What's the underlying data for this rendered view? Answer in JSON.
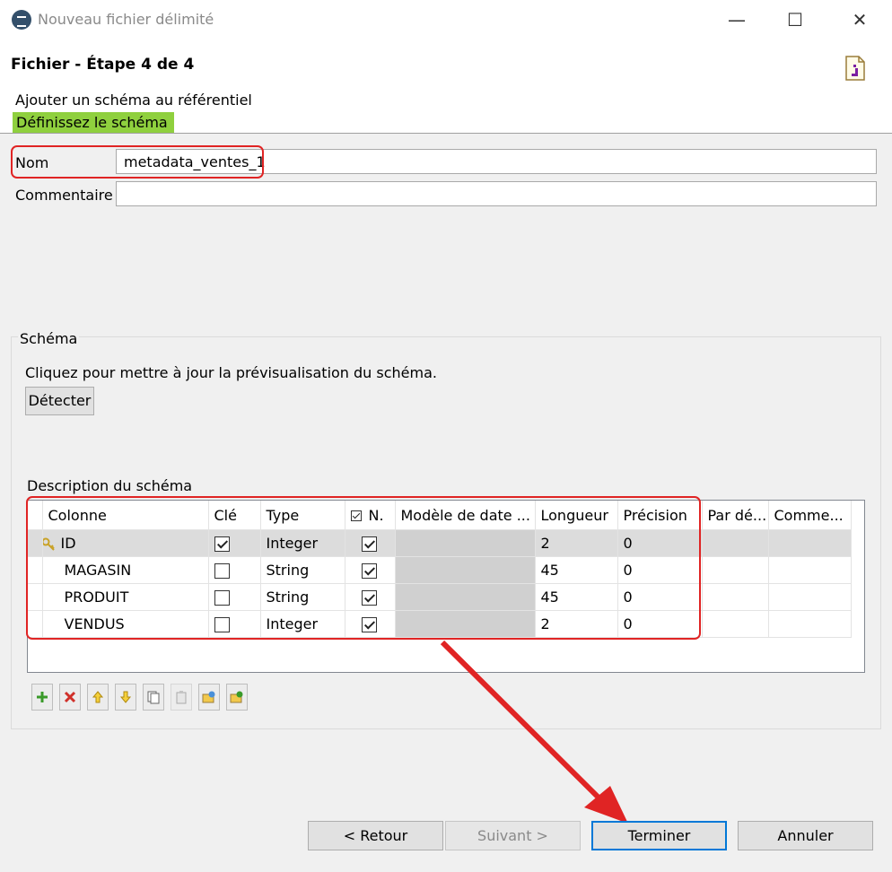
{
  "window": {
    "title": "Nouveau fichier délimité",
    "controls": {
      "minimize": "—",
      "maximize": "☐",
      "close": "✕"
    }
  },
  "header": {
    "step_title": "Fichier - Étape 4 de 4",
    "subtitle": "Ajouter un schéma au référentiel",
    "message": "Définissez le schéma"
  },
  "form": {
    "name_label": "Nom",
    "name_value": "metadata_ventes_1",
    "comment_label": "Commentaire",
    "comment_value": ""
  },
  "schema_group": {
    "label": "Schéma",
    "refresh_hint": "Cliquez pour mettre à jour la prévisualisation du schéma.",
    "detect_button": "Détecter",
    "description_label": "Description du schéma"
  },
  "table": {
    "columns": [
      "Colonne",
      "Clé",
      "Type",
      "N.",
      "Modèle de date ...",
      "Longueur",
      "Précision",
      "Par dé...",
      "Comme..."
    ],
    "rows": [
      {
        "name": "ID",
        "key": true,
        "type": "Integer",
        "nullable": true,
        "length": "2",
        "precision": "0",
        "selected": true
      },
      {
        "name": "MAGASIN",
        "key": false,
        "type": "String",
        "nullable": true,
        "length": "45",
        "precision": "0",
        "selected": false
      },
      {
        "name": "PRODUIT",
        "key": false,
        "type": "String",
        "nullable": true,
        "length": "45",
        "precision": "0",
        "selected": false
      },
      {
        "name": "VENDUS",
        "key": false,
        "type": "Integer",
        "nullable": true,
        "length": "2",
        "precision": "0",
        "selected": false
      }
    ]
  },
  "toolbar": [
    "add-icon",
    "delete-icon",
    "move-up-icon",
    "move-down-icon",
    "copy-icon",
    "paste-icon",
    "import-icon",
    "export-icon"
  ],
  "buttons": {
    "back": "< Retour",
    "next": "Suivant >",
    "finish": "Terminer",
    "cancel": "Annuler"
  },
  "colors": {
    "accent_green": "#8fd03e",
    "annotation_red": "#e02424",
    "default_button_blue": "#0078d7"
  }
}
